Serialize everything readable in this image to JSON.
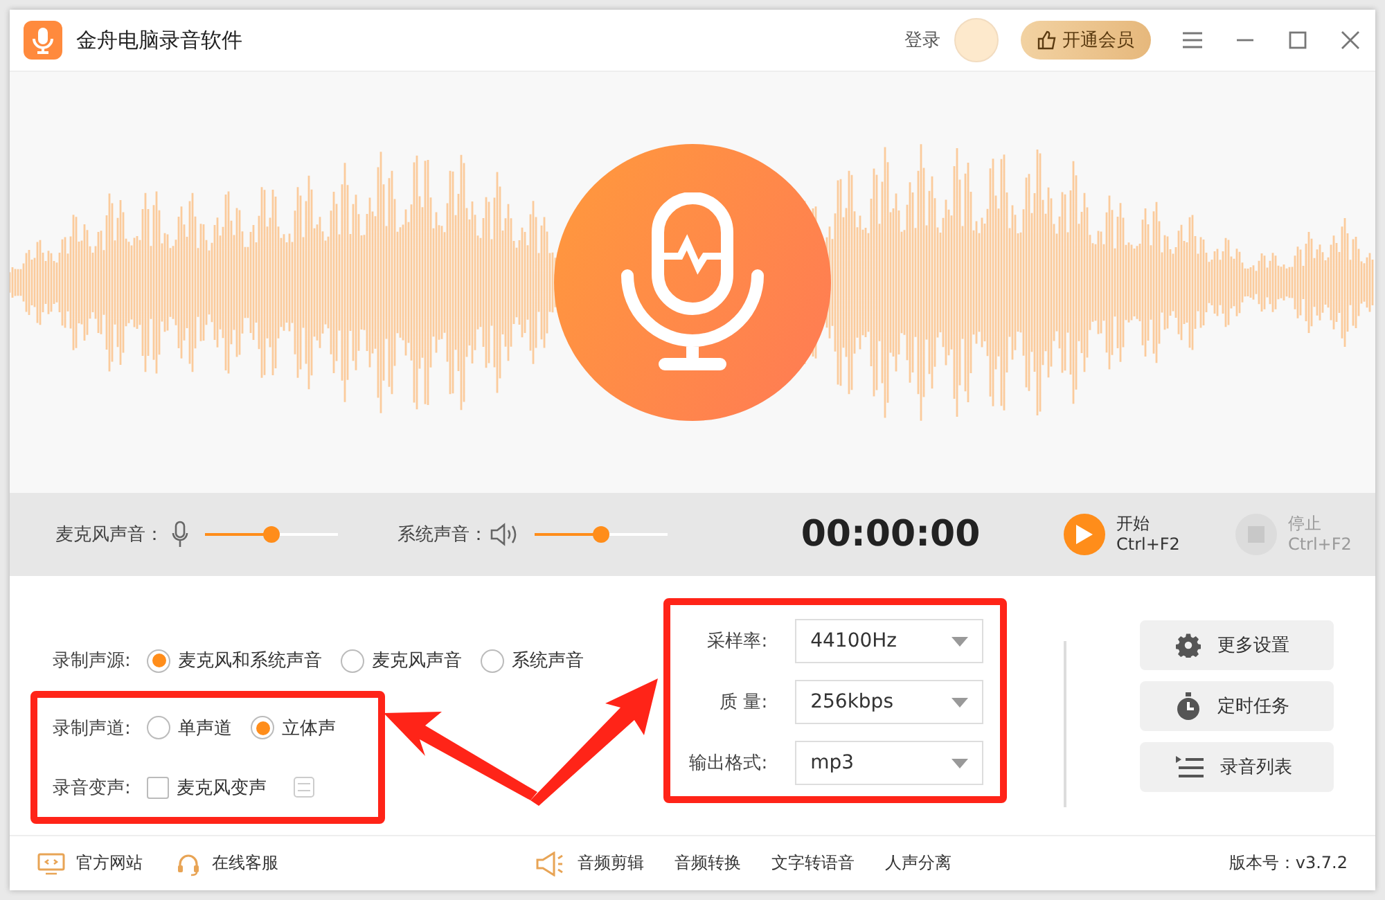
{
  "window": {
    "title": "金舟电脑录音软件",
    "login": "登录",
    "vip_button": "开通会员"
  },
  "controls": {
    "mic_label": "麦克风声音：",
    "mic_volume": {
      "level": 0.5
    },
    "system_label": "系统声音：",
    "system_volume": {
      "level": 0.5
    },
    "timer": "00:00:00",
    "start": {
      "label": "开始",
      "shortcut": "Ctrl+F2",
      "disabled": false
    },
    "stop": {
      "label": "停止",
      "shortcut": "Ctrl+F2",
      "disabled": true
    }
  },
  "settings": {
    "source": {
      "label": "录制声源:",
      "options": [
        {
          "label": "麦克风和系统声音",
          "selected": true
        },
        {
          "label": "麦克风声音",
          "selected": false
        },
        {
          "label": "系统声音",
          "selected": false
        }
      ]
    },
    "channel": {
      "label": "录制声道:",
      "options": [
        {
          "label": "单声道",
          "selected": false
        },
        {
          "label": "立体声",
          "selected": true
        }
      ]
    },
    "voice_change": {
      "label": "录音变声:",
      "checkbox": {
        "label": "麦克风变声",
        "checked": false
      }
    },
    "selects": [
      {
        "label": "采样率:",
        "value": "44100Hz"
      },
      {
        "label": "质 量:",
        "value": "256kbps"
      },
      {
        "label": "输出格式:",
        "value": "mp3"
      }
    ],
    "buttons": [
      {
        "kind": "gear",
        "label": "更多设置"
      },
      {
        "kind": "timer",
        "label": "定时任务"
      },
      {
        "kind": "list",
        "label": "录音列表"
      }
    ]
  },
  "footer": {
    "links": [
      {
        "kind": "monitor",
        "label": "官方网站"
      },
      {
        "kind": "headset",
        "label": "在线客服"
      }
    ],
    "tools": [
      "音频剪辑",
      "音频转换",
      "文字转语音",
      "人声分离"
    ],
    "version": "版本号：v3.7.2"
  }
}
